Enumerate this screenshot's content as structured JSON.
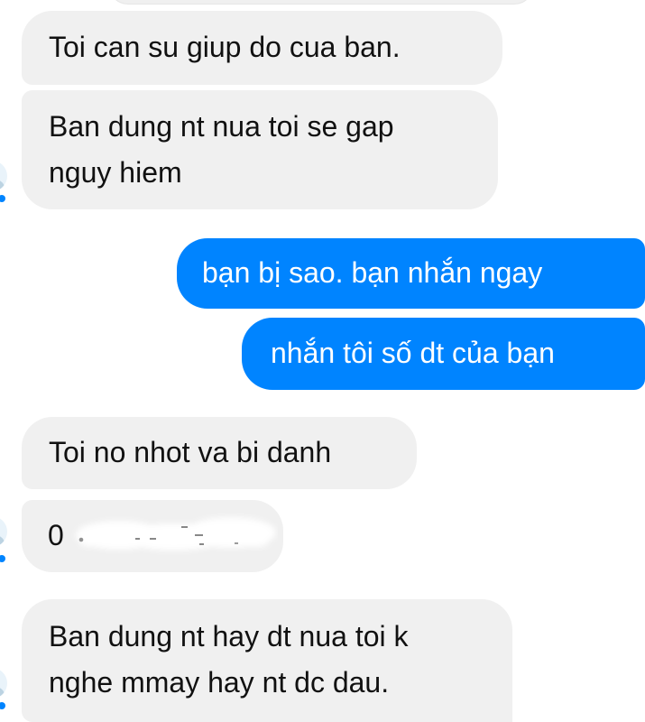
{
  "messages": [
    {
      "sender": "contact",
      "text": "Toi can su giup do cua ban."
    },
    {
      "sender": "contact",
      "lines": [
        "Ban dung nt nua toi se gap",
        "nguy hiem"
      ]
    },
    {
      "sender": "me",
      "text": "bạn bị sao. bạn nhắn ngay"
    },
    {
      "sender": "me",
      "text": "nhắn tôi số dt của bạn"
    },
    {
      "sender": "contact",
      "text": "Toi no nhot va bi danh"
    },
    {
      "sender": "contact",
      "visible_text": "0"
    },
    {
      "sender": "contact",
      "lines": [
        "Ban dung nt hay dt nua toi k",
        "nghe mmay hay nt dc dau."
      ]
    }
  ],
  "colors": {
    "incoming_bubble": "#f0f0f0",
    "outgoing_bubble": "#0084ff",
    "incoming_text": "#111111",
    "outgoing_text": "#ffffff",
    "background": "#ffffff"
  },
  "icons": {
    "contact_avatar": "contact-avatar-icon",
    "read_receipt": "read-receipt-icon"
  }
}
